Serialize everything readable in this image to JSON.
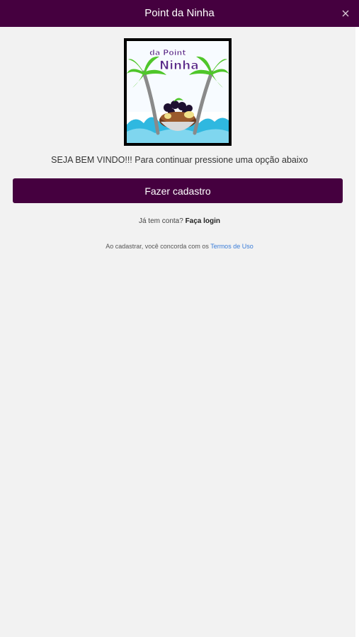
{
  "header": {
    "title": "Point da Ninha",
    "close_icon": "close-icon"
  },
  "logo": {
    "alt_text": "da Point Ninha",
    "line1": "da Point",
    "line2": "Ninha",
    "icon": "palm-tree-acai-bowl-logo"
  },
  "main": {
    "welcome_text": "SEJA BEM VINDO!!! Para continuar pressione uma opção abaixo",
    "signup_label": "Fazer cadastro",
    "login_prompt": "Já tem conta?",
    "login_link": "Faça login",
    "terms_prefix": "Ao cadastrar, você concorda com os",
    "terms_link": "Termos de Uso"
  },
  "colors": {
    "brand": "#45003f",
    "link": "#3b7dd8",
    "background": "#f2f2f2"
  }
}
